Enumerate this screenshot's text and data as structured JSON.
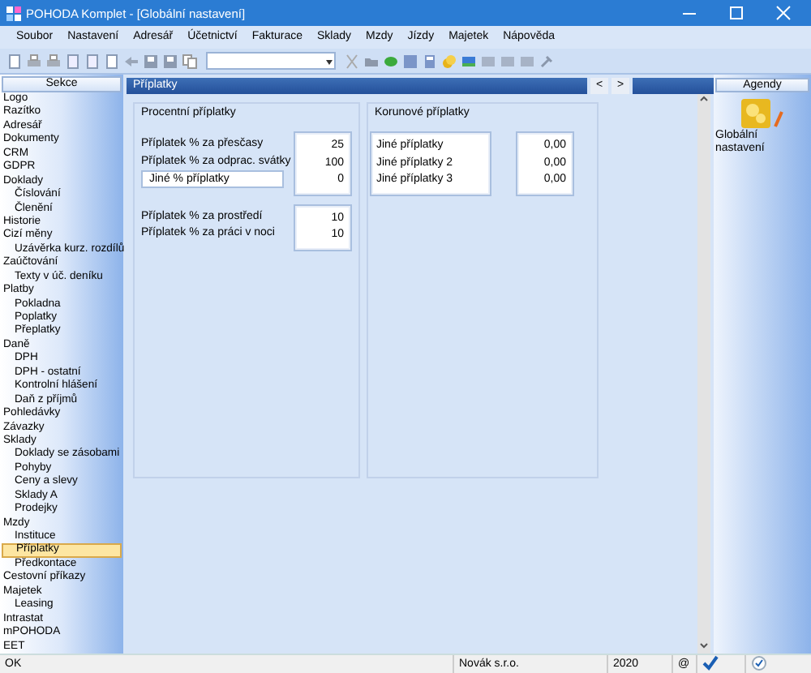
{
  "window": {
    "title": "POHODA Komplet - [Globální nastavení]"
  },
  "menu": [
    "Soubor",
    "Nastavení",
    "Adresář",
    "Účetnictví",
    "Fakturace",
    "Sklady",
    "Mzdy",
    "Jízdy",
    "Majetek",
    "Nápověda"
  ],
  "sidebar": {
    "title": "Sekce",
    "items": [
      {
        "label": "Logo",
        "selected": false
      },
      {
        "label": "Razítko",
        "selected": false
      },
      {
        "label": "Adresář",
        "selected": false
      },
      {
        "label": "Dokumenty",
        "selected": false
      },
      {
        "label": "CRM",
        "selected": false
      },
      {
        "label": "GDPR",
        "selected": false
      },
      {
        "label": "Doklady",
        "selected": false,
        "children": [
          {
            "label": "Číslování",
            "selected": false
          },
          {
            "label": "Členění",
            "selected": false
          }
        ]
      },
      {
        "label": "Historie",
        "selected": false
      },
      {
        "label": "Cizí měny",
        "selected": false,
        "children": [
          {
            "label": "Uzávěrka kurz. rozdílů",
            "selected": false
          }
        ]
      },
      {
        "label": "Zaúčtování",
        "selected": false,
        "children": [
          {
            "label": "Texty v úč. deníku",
            "selected": false
          }
        ]
      },
      {
        "label": "Platby",
        "selected": false,
        "children": [
          {
            "label": "Pokladna",
            "selected": false
          },
          {
            "label": "Poplatky",
            "selected": false
          },
          {
            "label": "Přeplatky",
            "selected": false
          }
        ]
      },
      {
        "label": "Daně",
        "selected": false,
        "children": [
          {
            "label": "DPH",
            "selected": false
          },
          {
            "label": "DPH - ostatní",
            "selected": false
          },
          {
            "label": "Kontrolní hlášení",
            "selected": false
          },
          {
            "label": "Daň z příjmů",
            "selected": false
          }
        ]
      },
      {
        "label": "Pohledávky",
        "selected": false
      },
      {
        "label": "Závazky",
        "selected": false
      },
      {
        "label": "Sklady",
        "selected": false,
        "children": [
          {
            "label": "Doklady se zásobami",
            "selected": false
          },
          {
            "label": "Pohyby",
            "selected": false
          },
          {
            "label": "Ceny a slevy",
            "selected": false
          },
          {
            "label": "Sklady A",
            "selected": false
          },
          {
            "label": "Prodejky",
            "selected": false
          }
        ]
      },
      {
        "label": "Mzdy",
        "selected": false,
        "children": [
          {
            "label": "Instituce",
            "selected": false
          },
          {
            "label": "Příplatky",
            "selected": true
          },
          {
            "label": "Předkontace",
            "selected": false
          }
        ]
      },
      {
        "label": "Cestovní příkazy",
        "selected": false
      },
      {
        "label": "Majetek",
        "selected": false,
        "children": [
          {
            "label": "Leasing",
            "selected": false
          }
        ]
      },
      {
        "label": "Intrastat",
        "selected": false
      },
      {
        "label": "mPOHODA",
        "selected": false
      },
      {
        "label": "EET",
        "selected": false
      }
    ]
  },
  "panel": {
    "title": "Příplatky",
    "nav": [
      "<",
      ">"
    ]
  },
  "percent_surcharges": {
    "title": "Procentní příplatky",
    "groups": [
      [
        {
          "kind": "label",
          "label": "Příplatek % za přesčasy",
          "value": "25"
        },
        {
          "kind": "label",
          "label": "Příplatek % za odprac. svátky",
          "value": "100"
        },
        {
          "kind": "input",
          "label": "Jiné % příplatky",
          "value": "0"
        }
      ],
      [
        {
          "kind": "label",
          "label": "Příplatek % za prostředí",
          "value": "10"
        },
        {
          "kind": "label",
          "label": "Příplatek % za práci v noci",
          "value": "10"
        }
      ]
    ]
  },
  "fixed_surcharges": {
    "title": "Korunové příplatky",
    "rows": [
      {
        "label": "Jiné příplatky",
        "value": "0,00"
      },
      {
        "label": "Jiné příplatky 2",
        "value": "0,00"
      },
      {
        "label": "Jiné příplatky 3",
        "value": "0,00"
      }
    ]
  },
  "agendas": {
    "title": "Agendy",
    "items": [
      {
        "label": "Globální nastavení"
      }
    ]
  },
  "status_bar": {
    "message": "OK",
    "company": "Novák s.r.o.",
    "year": "2020",
    "at": "@"
  }
}
